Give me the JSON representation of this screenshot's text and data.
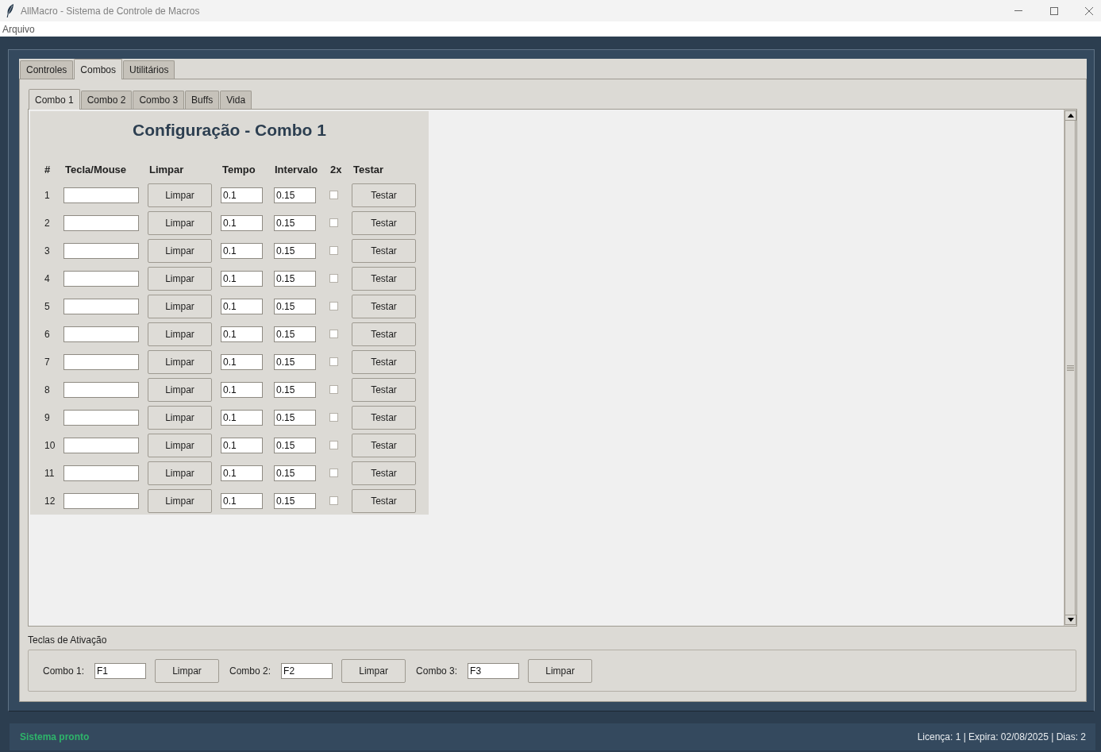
{
  "window": {
    "title": "AllMacro - Sistema de Controle de Macros"
  },
  "menu_bar": {
    "items": [
      "Arquivo"
    ]
  },
  "tabs": [
    {
      "label": "Controles",
      "selected": false
    },
    {
      "label": "Combos",
      "selected": true
    },
    {
      "label": "Utilitários",
      "selected": false
    }
  ],
  "sub_tabs": [
    {
      "label": "Combo 1",
      "selected": true
    },
    {
      "label": "Combo 2",
      "selected": false
    },
    {
      "label": "Combo 3",
      "selected": false
    },
    {
      "label": "Buffs",
      "selected": false
    },
    {
      "label": "Vida",
      "selected": false
    }
  ],
  "config": {
    "title": "Configuração - Combo 1",
    "columns": [
      "#",
      "Tecla/Mouse",
      "Limpar",
      "Tempo",
      "Intervalo",
      "2x",
      "Testar"
    ],
    "rows": [
      {
        "number": "1",
        "clear_button": "Limpar",
        "tempo": "0.1",
        "intervalo": "0.15",
        "twice": false,
        "test_button": "Testar"
      },
      {
        "number": "2",
        "clear_button": "Limpar",
        "tempo": "0.1",
        "intervalo": "0.15",
        "twice": false,
        "test_button": "Testar"
      },
      {
        "number": "3",
        "clear_button": "Limpar",
        "tempo": "0.1",
        "intervalo": "0.15",
        "twice": false,
        "test_button": "Testar"
      },
      {
        "number": "4",
        "clear_button": "Limpar",
        "tempo": "0.1",
        "intervalo": "0.15",
        "twice": false,
        "test_button": "Testar"
      },
      {
        "number": "5",
        "clear_button": "Limpar",
        "tempo": "0.1",
        "intervalo": "0.15",
        "twice": false,
        "test_button": "Testar"
      },
      {
        "number": "6",
        "clear_button": "Limpar",
        "tempo": "0.1",
        "intervalo": "0.15",
        "twice": false,
        "test_button": "Testar"
      },
      {
        "number": "7",
        "clear_button": "Limpar",
        "tempo": "0.1",
        "intervalo": "0.15",
        "twice": false,
        "test_button": "Testar"
      },
      {
        "number": "8",
        "clear_button": "Limpar",
        "tempo": "0.1",
        "intervalo": "0.15",
        "twice": false,
        "test_button": "Testar"
      },
      {
        "number": "9",
        "clear_button": "Limpar",
        "tempo": "0.1",
        "intervalo": "0.15",
        "twice": false,
        "test_button": "Testar"
      },
      {
        "number": "10",
        "clear_button": "Limpar",
        "tempo": "0.1",
        "intervalo": "0.15",
        "twice": false,
        "test_button": "Testar"
      },
      {
        "number": "11",
        "clear_button": "Limpar",
        "tempo": "0.1",
        "intervalo": "0.15",
        "twice": false,
        "test_button": "Testar"
      },
      {
        "number": "12",
        "clear_button": "Limpar",
        "tempo": "0.1",
        "intervalo": "0.15",
        "twice": false,
        "test_button": "Testar"
      }
    ]
  },
  "activation": {
    "title": "Teclas de Ativação",
    "fields": [
      {
        "label": "Combo 1:",
        "value": "F1",
        "button": "Limpar"
      },
      {
        "label": "Combo 2:",
        "value": "F2",
        "button": "Limpar"
      },
      {
        "label": "Combo 3:",
        "value": "F3",
        "button": "Limpar"
      }
    ]
  },
  "status_bar": {
    "message": "Sistema pronto",
    "info": "Licença: 1 | Expira: 02/08/2025 | Dias: 2"
  }
}
